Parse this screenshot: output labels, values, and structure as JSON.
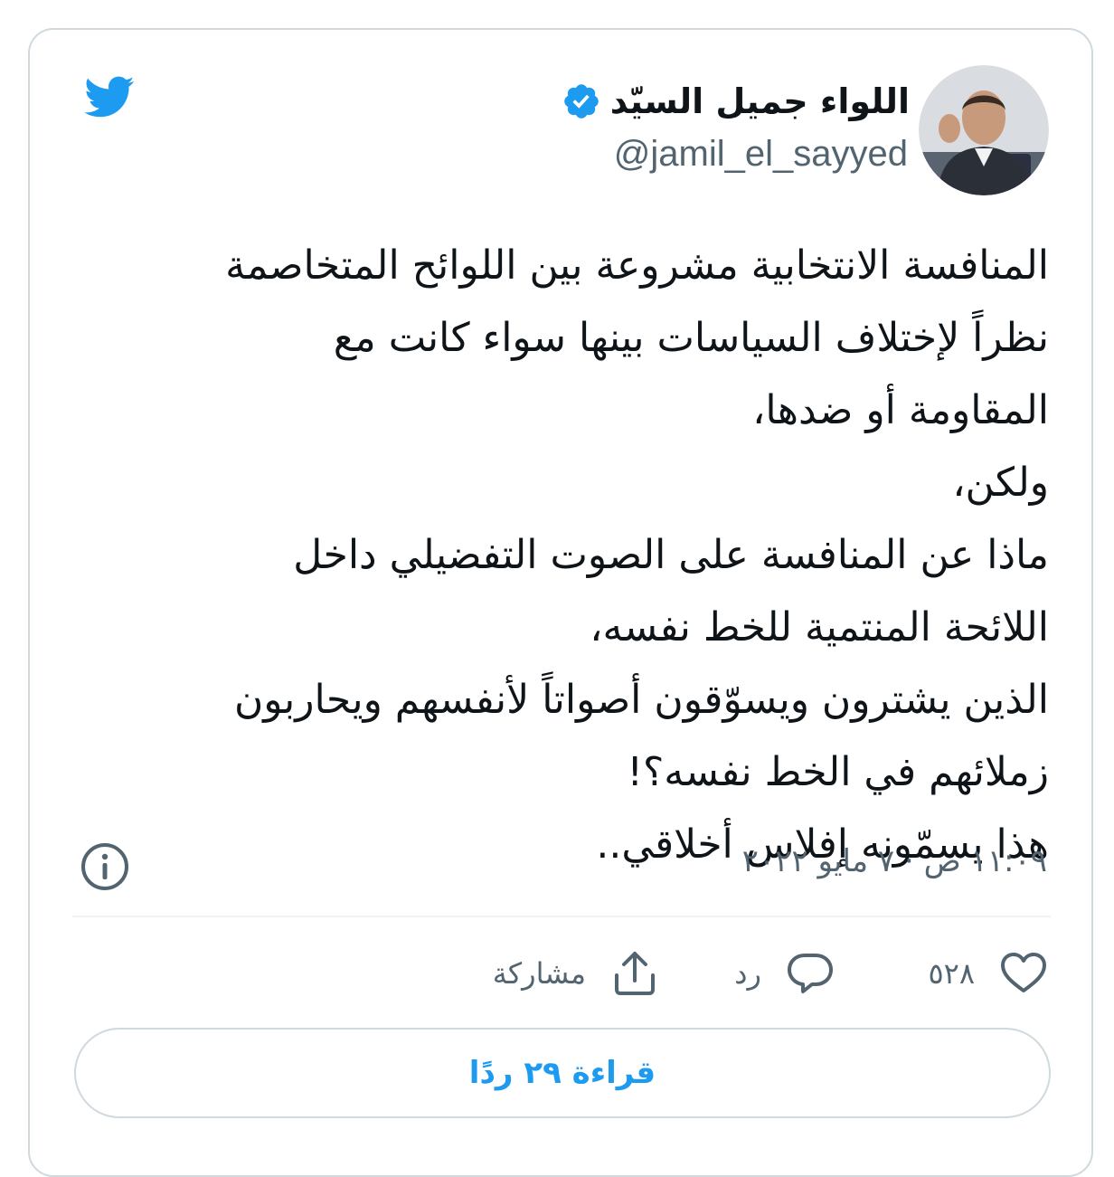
{
  "author": {
    "display_name": "اللواء جميل السيّد",
    "handle": "@jamil_el_sayyed",
    "verified": true
  },
  "tweet": {
    "lines": [
      "المنافسة الانتخابية مشروعة بين اللوائح المتخاصمة",
      "نظراً لإختلاف السياسات بينها سواء كانت مع",
      "المقاومة أو ضدها،",
      "ولكن،",
      "ماذا عن المنافسة على الصوت التفضيلي داخل",
      "اللائحة المنتمية للخط نفسه،",
      "الذين يشترون ويسوّقون أصواتاً لأنفسهم ويحاربون",
      "زملائهم في الخط نفسه؟!",
      "هذا يسمّونه إفلاس أخلاقي.."
    ],
    "timestamp": "١١:٠٩ ص · ٧ مايو ٢٠٢٢"
  },
  "actions": {
    "like_count": "٥٢٨",
    "reply_label": "رد",
    "share_label": "مشاركة"
  },
  "read_replies_label": "قراءة ٢٩ ردًا",
  "colors": {
    "accent": "#1d9bf0",
    "text": "#0f1419",
    "secondary": "#536471",
    "border": "#cfd9de"
  },
  "icons": {
    "logo": "twitter-bird-icon",
    "verified": "verified-badge-icon",
    "info": "info-icon",
    "like": "heart-icon",
    "reply": "speech-bubble-icon",
    "share": "share-upload-icon"
  }
}
